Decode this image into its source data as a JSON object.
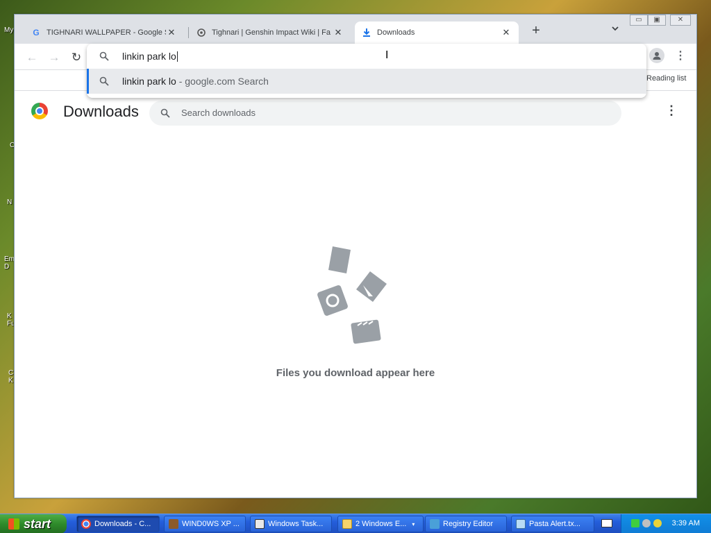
{
  "desktop": {
    "labels": [
      "My",
      "C",
      "N",
      "Em D",
      "K Fu",
      "C K"
    ]
  },
  "tabs": [
    {
      "title": "TIGHNARI WALLPAPER - Google Se",
      "favicon": "google-icon",
      "active": false
    },
    {
      "title": "Tighnari | Genshin Impact Wiki | Fa",
      "favicon": "wiki-icon",
      "active": false
    },
    {
      "title": "Downloads",
      "favicon": "download-icon",
      "active": true
    }
  ],
  "window_controls": {
    "minimize": "▭",
    "maximize": "▣",
    "close": "✕"
  },
  "omnibox": {
    "input_value": "linkin park lo",
    "suggestion_query": "linkin park lo",
    "suggestion_suffix": " - google.com Search"
  },
  "bookmarks": {
    "reading_list": "Reading list"
  },
  "downloads": {
    "title": "Downloads",
    "search_placeholder": "Search downloads",
    "empty_message": "Files you download appear here"
  },
  "taskbar": {
    "start_label": "start",
    "buttons": [
      {
        "label": "Downloads - C...",
        "icon": "chrome-icon",
        "active": true
      },
      {
        "label": "WIND0WS XP ...",
        "icon": "game-icon",
        "active": false
      },
      {
        "label": "Windows Task...",
        "icon": "task-manager-icon",
        "active": false
      },
      {
        "label": "2 Windows E...",
        "icon": "folder-icon",
        "active": false
      },
      {
        "label": "Registry Editor",
        "icon": "registry-icon",
        "active": false
      },
      {
        "label": "Pasta Alert.tx...",
        "icon": "notepad-icon",
        "active": false
      }
    ],
    "clock": "3:39 AM"
  }
}
